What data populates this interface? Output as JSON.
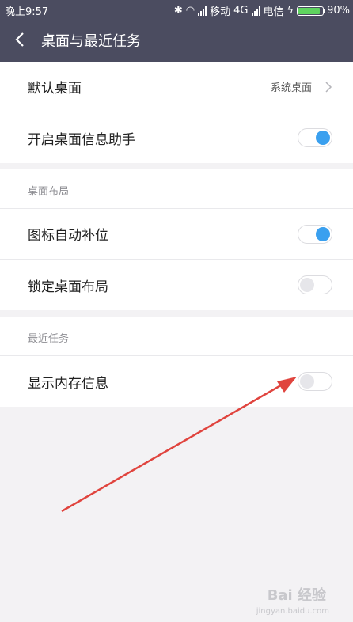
{
  "status_bar": {
    "time": "晚上9:57",
    "carrier1": "移动",
    "network": "4G",
    "carrier2": "电信",
    "battery": "90%",
    "battery_level": 0.9
  },
  "header": {
    "title": "桌面与最近任务"
  },
  "settings": {
    "default_desktop": {
      "label": "默认桌面",
      "value": "系统桌面"
    },
    "desktop_assistant": {
      "label": "开启桌面信息助手",
      "enabled": true
    }
  },
  "layout_section": {
    "heading": "桌面布局",
    "icon_autofill": {
      "label": "图标自动补位",
      "enabled": true
    },
    "lock_layout": {
      "label": "锁定桌面布局",
      "enabled": false
    }
  },
  "recent_section": {
    "heading": "最近任务",
    "show_memory": {
      "label": "显示内存信息",
      "enabled": false
    }
  },
  "watermark": {
    "text": "Bai 经验",
    "sub": "jingyan.baidu.com"
  },
  "colors": {
    "header": "#4b4c60",
    "toggle_on": "#3aa0ef",
    "arrow": "#e0443e"
  }
}
